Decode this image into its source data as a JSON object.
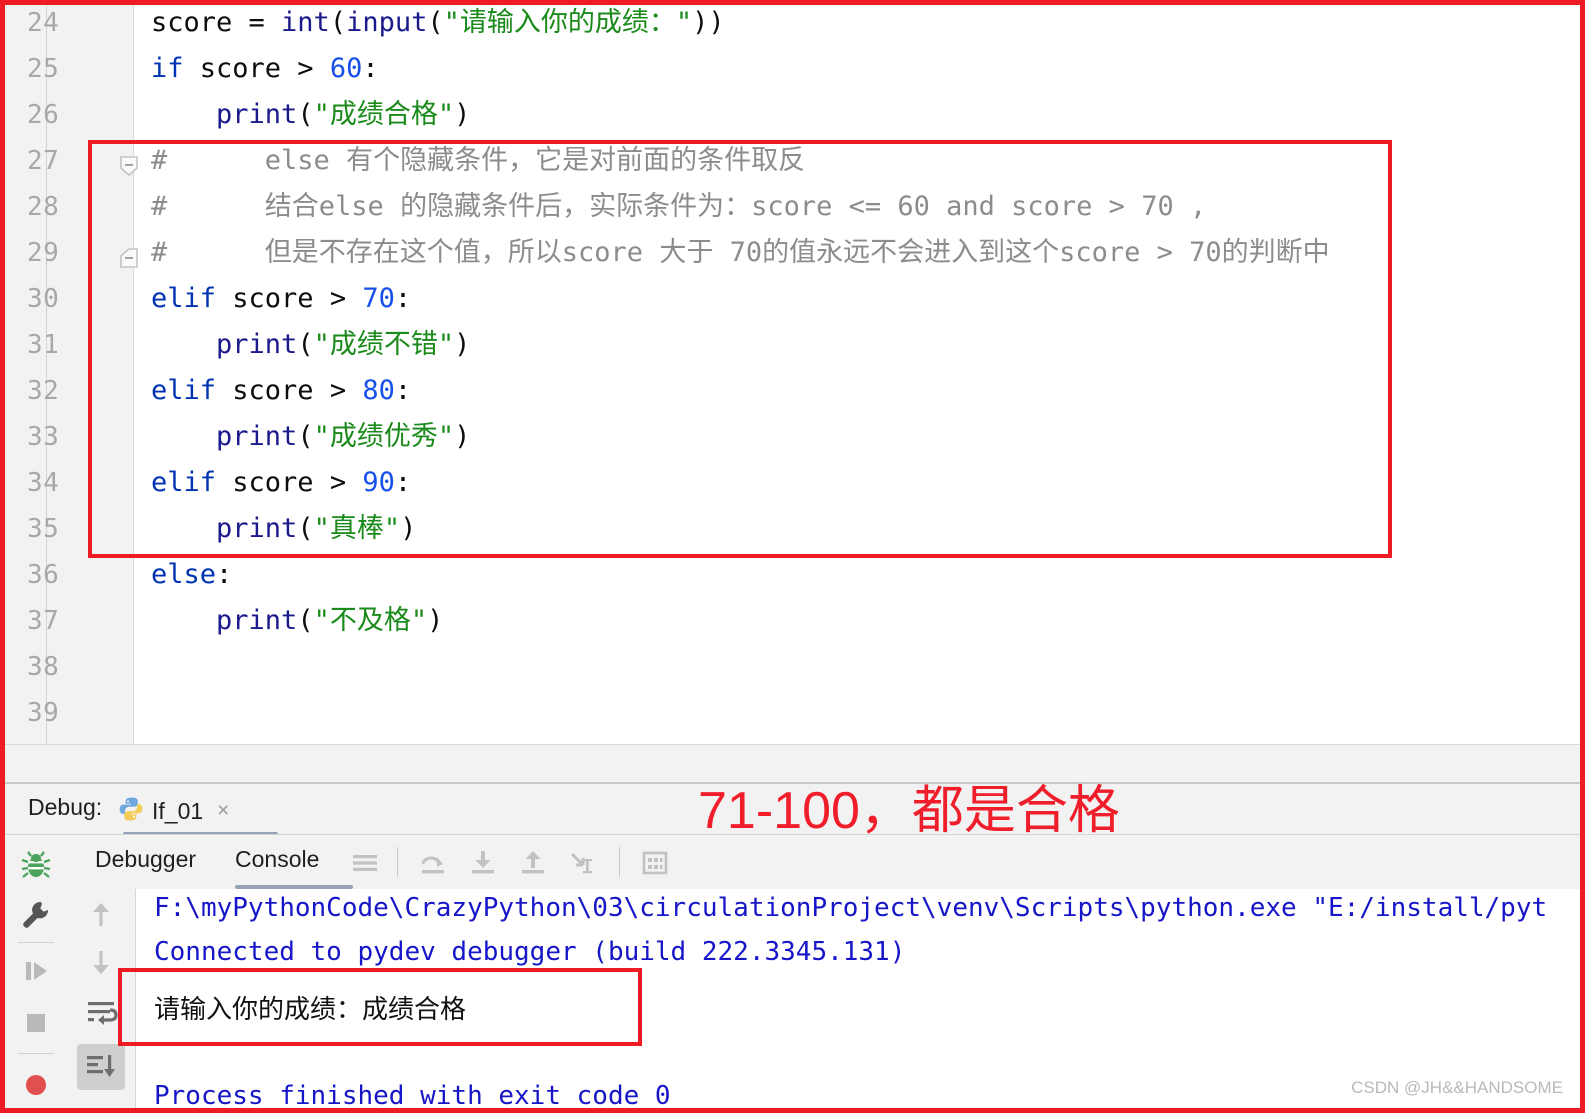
{
  "editor": {
    "lines": [
      {
        "num": "24",
        "fold": "none",
        "segments": [
          {
            "t": "score = ",
            "c": "plain"
          },
          {
            "t": "int",
            "c": "bfn"
          },
          {
            "t": "(",
            "c": "plain"
          },
          {
            "t": "input",
            "c": "bfn"
          },
          {
            "t": "(",
            "c": "plain"
          },
          {
            "t": "\"请输入你的成绩：\"",
            "c": "str"
          },
          {
            "t": "))",
            "c": "plain"
          }
        ]
      },
      {
        "num": "25",
        "fold": "none",
        "segments": [
          {
            "t": "if",
            "c": "kw"
          },
          {
            "t": " score > ",
            "c": "plain"
          },
          {
            "t": "60",
            "c": "num"
          },
          {
            "t": ":",
            "c": "plain"
          }
        ]
      },
      {
        "num": "26",
        "fold": "none",
        "segments": [
          {
            "t": "    ",
            "c": "plain"
          },
          {
            "t": "print",
            "c": "bfn"
          },
          {
            "t": "(",
            "c": "plain"
          },
          {
            "t": "\"成绩合格\"",
            "c": "str"
          },
          {
            "t": ")",
            "c": "plain"
          }
        ]
      },
      {
        "num": "27",
        "fold": "open",
        "segments": [
          {
            "t": "#      else 有个隐藏条件，它是对前面的条件取反",
            "c": "cmt"
          }
        ]
      },
      {
        "num": "28",
        "fold": "none",
        "segments": [
          {
            "t": "#      结合else 的隐藏条件后，实际条件为：score <= 60 and score > 70 ,",
            "c": "cmt"
          }
        ]
      },
      {
        "num": "29",
        "fold": "close",
        "segments": [
          {
            "t": "#      但是不存在这个值，所以score 大于 70的值永远不会进入到这个score > 70的判断中",
            "c": "cmt"
          }
        ]
      },
      {
        "num": "30",
        "fold": "none",
        "segments": [
          {
            "t": "elif",
            "c": "kw"
          },
          {
            "t": " score > ",
            "c": "plain"
          },
          {
            "t": "70",
            "c": "num"
          },
          {
            "t": ":",
            "c": "plain"
          }
        ]
      },
      {
        "num": "31",
        "fold": "none",
        "segments": [
          {
            "t": "    ",
            "c": "plain"
          },
          {
            "t": "print",
            "c": "bfn"
          },
          {
            "t": "(",
            "c": "plain"
          },
          {
            "t": "\"成绩不错\"",
            "c": "str"
          },
          {
            "t": ")",
            "c": "plain"
          }
        ]
      },
      {
        "num": "32",
        "fold": "none",
        "segments": [
          {
            "t": "elif",
            "c": "kw"
          },
          {
            "t": " score > ",
            "c": "plain"
          },
          {
            "t": "80",
            "c": "num"
          },
          {
            "t": ":",
            "c": "plain"
          }
        ]
      },
      {
        "num": "33",
        "fold": "none",
        "segments": [
          {
            "t": "    ",
            "c": "plain"
          },
          {
            "t": "print",
            "c": "bfn"
          },
          {
            "t": "(",
            "c": "plain"
          },
          {
            "t": "\"成绩优秀\"",
            "c": "str"
          },
          {
            "t": ")",
            "c": "plain"
          }
        ]
      },
      {
        "num": "34",
        "fold": "none",
        "segments": [
          {
            "t": "elif",
            "c": "kw"
          },
          {
            "t": " score > ",
            "c": "plain"
          },
          {
            "t": "90",
            "c": "num"
          },
          {
            "t": ":",
            "c": "plain"
          }
        ]
      },
      {
        "num": "35",
        "fold": "none",
        "segments": [
          {
            "t": "    ",
            "c": "plain"
          },
          {
            "t": "print",
            "c": "bfn"
          },
          {
            "t": "(",
            "c": "plain"
          },
          {
            "t": "\"真棒\"",
            "c": "str"
          },
          {
            "t": ")",
            "c": "plain"
          }
        ]
      },
      {
        "num": "36",
        "fold": "none",
        "segments": [
          {
            "t": "else",
            "c": "kw"
          },
          {
            "t": ":",
            "c": "plain"
          }
        ]
      },
      {
        "num": "37",
        "fold": "none",
        "segments": [
          {
            "t": "    ",
            "c": "plain"
          },
          {
            "t": "print",
            "c": "bfn"
          },
          {
            "t": "(",
            "c": "plain"
          },
          {
            "t": "\"不及格\"",
            "c": "str"
          },
          {
            "t": ")",
            "c": "plain"
          }
        ]
      },
      {
        "num": "38",
        "fold": "none",
        "segments": []
      },
      {
        "num": "39",
        "fold": "none",
        "segments": []
      }
    ]
  },
  "debug": {
    "label": "Debug:",
    "tab_name": "If_01",
    "tab_icon": "python-icon",
    "close_label": "×",
    "tabs": [
      {
        "label": "Debugger",
        "active": false
      },
      {
        "label": "Console",
        "active": true
      }
    ],
    "toolbar_icons": [
      "menu-icon",
      "step-over-icon",
      "step-into-icon",
      "step-out-icon",
      "run-to-cursor-icon",
      "evaluate-expression-icon"
    ],
    "rail_icons": [
      "debug-bug-icon",
      "settings-wrench-icon",
      "resume-program-icon",
      "stop-program-icon",
      "breakpoint-dot-icon"
    ],
    "step_rail_icons": [
      "arrow-up-icon",
      "arrow-down-icon",
      "soft-wrap-icon",
      "scroll-to-end-icon"
    ]
  },
  "console": {
    "lines": [
      {
        "text": "F:\\myPythonCode\\CrazyPython\\03\\circulationProject\\venv\\Scripts\\python.exe \"E:/install/pyt",
        "color": "blue"
      },
      {
        "text": "Connected to pydev debugger (build 222.3345.131)",
        "color": "blue"
      },
      {
        "text": "请输入你的成绩：成绩合格",
        "color": "black"
      },
      {
        "text": "Process finished with exit code 0",
        "color": "blue"
      }
    ]
  },
  "annotations": {
    "note_text": "71-100，都是合格",
    "note_color": "#f01d2a",
    "box_color": "#ee1b24"
  },
  "watermark": "CSDN @JH&&HANDSOME"
}
